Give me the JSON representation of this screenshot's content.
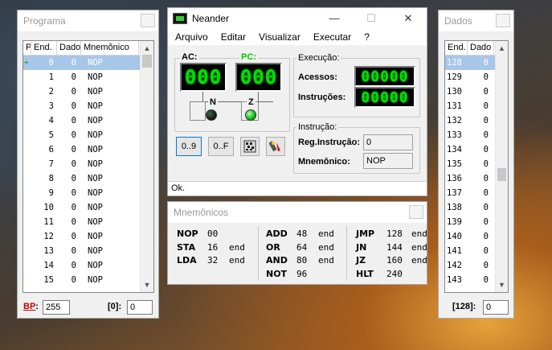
{
  "programa": {
    "title": "Programa",
    "columns": [
      "P",
      "End.",
      "Dado",
      "Mnemônico"
    ],
    "rows": [
      {
        "p": "➔",
        "end": "0",
        "dado": "0",
        "mne": "NOP"
      },
      {
        "p": "",
        "end": "1",
        "dado": "0",
        "mne": "NOP"
      },
      {
        "p": "",
        "end": "2",
        "dado": "0",
        "mne": "NOP"
      },
      {
        "p": "",
        "end": "3",
        "dado": "0",
        "mne": "NOP"
      },
      {
        "p": "",
        "end": "4",
        "dado": "0",
        "mne": "NOP"
      },
      {
        "p": "",
        "end": "5",
        "dado": "0",
        "mne": "NOP"
      },
      {
        "p": "",
        "end": "6",
        "dado": "0",
        "mne": "NOP"
      },
      {
        "p": "",
        "end": "7",
        "dado": "0",
        "mne": "NOP"
      },
      {
        "p": "",
        "end": "8",
        "dado": "0",
        "mne": "NOP"
      },
      {
        "p": "",
        "end": "9",
        "dado": "0",
        "mne": "NOP"
      },
      {
        "p": "",
        "end": "10",
        "dado": "0",
        "mne": "NOP"
      },
      {
        "p": "",
        "end": "11",
        "dado": "0",
        "mne": "NOP"
      },
      {
        "p": "",
        "end": "12",
        "dado": "0",
        "mne": "NOP"
      },
      {
        "p": "",
        "end": "13",
        "dado": "0",
        "mne": "NOP"
      },
      {
        "p": "",
        "end": "14",
        "dado": "0",
        "mne": "NOP"
      },
      {
        "p": "",
        "end": "15",
        "dado": "0",
        "mne": "NOP"
      }
    ],
    "bp_label": "BP",
    "bp_value": "255",
    "addr_label": "[0]:",
    "addr_value": "0"
  },
  "dados": {
    "title": "Dados",
    "columns": [
      "End.",
      "Dado"
    ],
    "rows": [
      {
        "end": "128",
        "dado": "0"
      },
      {
        "end": "129",
        "dado": "0"
      },
      {
        "end": "130",
        "dado": "0"
      },
      {
        "end": "131",
        "dado": "0"
      },
      {
        "end": "132",
        "dado": "0"
      },
      {
        "end": "133",
        "dado": "0"
      },
      {
        "end": "134",
        "dado": "0"
      },
      {
        "end": "135",
        "dado": "0"
      },
      {
        "end": "136",
        "dado": "0"
      },
      {
        "end": "137",
        "dado": "0"
      },
      {
        "end": "138",
        "dado": "0"
      },
      {
        "end": "139",
        "dado": "0"
      },
      {
        "end": "140",
        "dado": "0"
      },
      {
        "end": "141",
        "dado": "0"
      },
      {
        "end": "142",
        "dado": "0"
      },
      {
        "end": "143",
        "dado": "0"
      }
    ],
    "addr_label": "[128]:",
    "addr_value": "0"
  },
  "neander": {
    "title": "Neander",
    "minimize": "—",
    "maximize": "☐",
    "close": "✕",
    "menu": [
      "Arquivo",
      "Editar",
      "Visualizar",
      "Executar",
      "?"
    ],
    "ac_label": "AC:",
    "ac_value": "000",
    "pc_label": "PC:",
    "pc_value": "000",
    "n_label": "N",
    "z_label": "Z",
    "execucao_label": "Execução:",
    "acessos_label": "Acessos:",
    "acessos_value": "00000",
    "instrucoes_label": "Instruções:",
    "instrucoes_value": "00000",
    "btn_dec": "0..9",
    "btn_hex": "0..F",
    "instrucao_label": "Instrução:",
    "reg_label": "Reg.Instrução:",
    "reg_value": "0",
    "mnem_label": "Mnemônico:",
    "mnem_value": "NOP",
    "status": "Ok."
  },
  "mnemonicos": {
    "title": "Mnemônicos",
    "col1": [
      {
        "mn": "NOP",
        "code": "00",
        "end": ""
      },
      {
        "mn": "STA",
        "code": "16",
        "end": "end"
      },
      {
        "mn": "LDA",
        "code": "32",
        "end": "end"
      }
    ],
    "col2": [
      {
        "mn": "ADD",
        "code": "48",
        "end": "end"
      },
      {
        "mn": "OR",
        "code": "64",
        "end": "end"
      },
      {
        "mn": "AND",
        "code": "80",
        "end": "end"
      },
      {
        "mn": "NOT",
        "code": "96",
        "end": ""
      }
    ],
    "col3": [
      {
        "mn": "JMP",
        "code": "128",
        "end": "end"
      },
      {
        "mn": "JN",
        "code": "144",
        "end": "end"
      },
      {
        "mn": "JZ",
        "code": "160",
        "end": "end"
      },
      {
        "mn": "HLT",
        "code": "240",
        "end": ""
      }
    ]
  },
  "colors": {
    "lcd_green": "#00e000",
    "pc_label_green": "#00cc00",
    "selection": "#a8c6e8",
    "bp_red": "#c00000"
  }
}
